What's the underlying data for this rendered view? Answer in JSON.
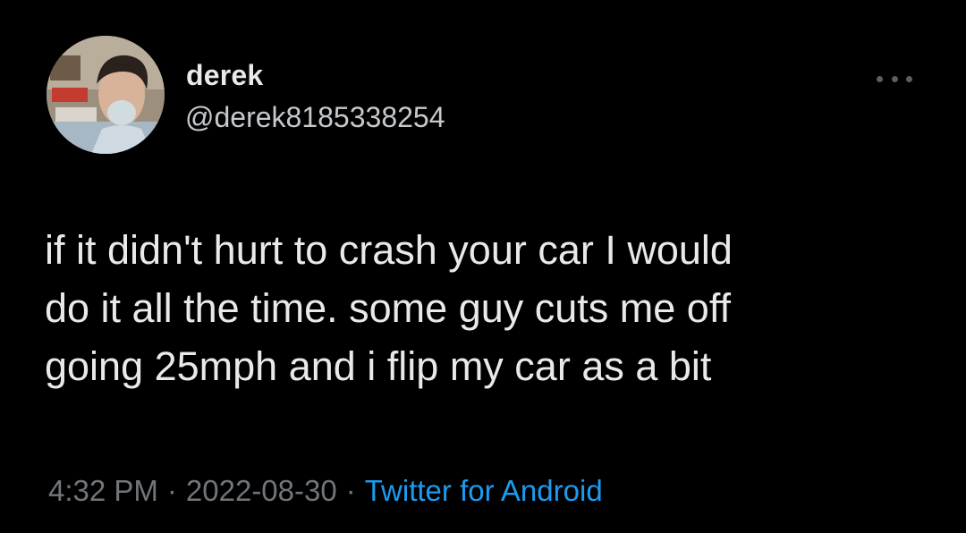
{
  "author": {
    "display_name": "derek",
    "handle": "@derek8185338254",
    "avatar_description_icon": "profile-photo"
  },
  "tweet": {
    "text": "if it didn't hurt to crash your car I would\ndo it all the time. some guy cuts me off\ngoing 25mph and i flip my car as a bit"
  },
  "meta": {
    "time": "4:32 PM",
    "separator": "·",
    "date": "2022-08-30",
    "source": "Twitter for Android"
  },
  "colors": {
    "background": "#000000",
    "text": "#e7e9ea",
    "muted": "#71767b",
    "link": "#1d9bf0"
  },
  "icons": {
    "more": "more-horizontal-icon"
  }
}
